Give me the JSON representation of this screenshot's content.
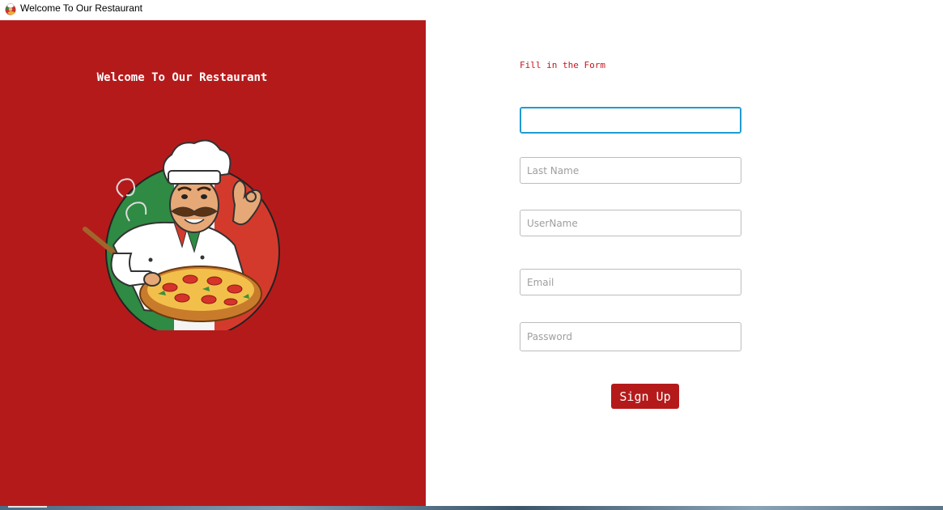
{
  "window": {
    "title": "Welcome To Our Restaurant",
    "icon": "chef-pizza-app-icon"
  },
  "left_panel": {
    "background": "#b51a1b",
    "welcome_text": "Welcome To Our Restaurant",
    "illustration": "chef-with-pizza-illustration"
  },
  "form": {
    "heading": "Fill in the Form",
    "fields": {
      "first_name": {
        "value": "",
        "placeholder": ""
      },
      "last_name": {
        "value": "",
        "placeholder": "Last Name"
      },
      "username": {
        "value": "",
        "placeholder": "UserName"
      },
      "email": {
        "value": "",
        "placeholder": "Email"
      },
      "password": {
        "value": "",
        "placeholder": "Password"
      }
    },
    "signup_label": "Sign Up",
    "accent_color": "#b51a1b",
    "focus_color": "#1f9bd1"
  }
}
